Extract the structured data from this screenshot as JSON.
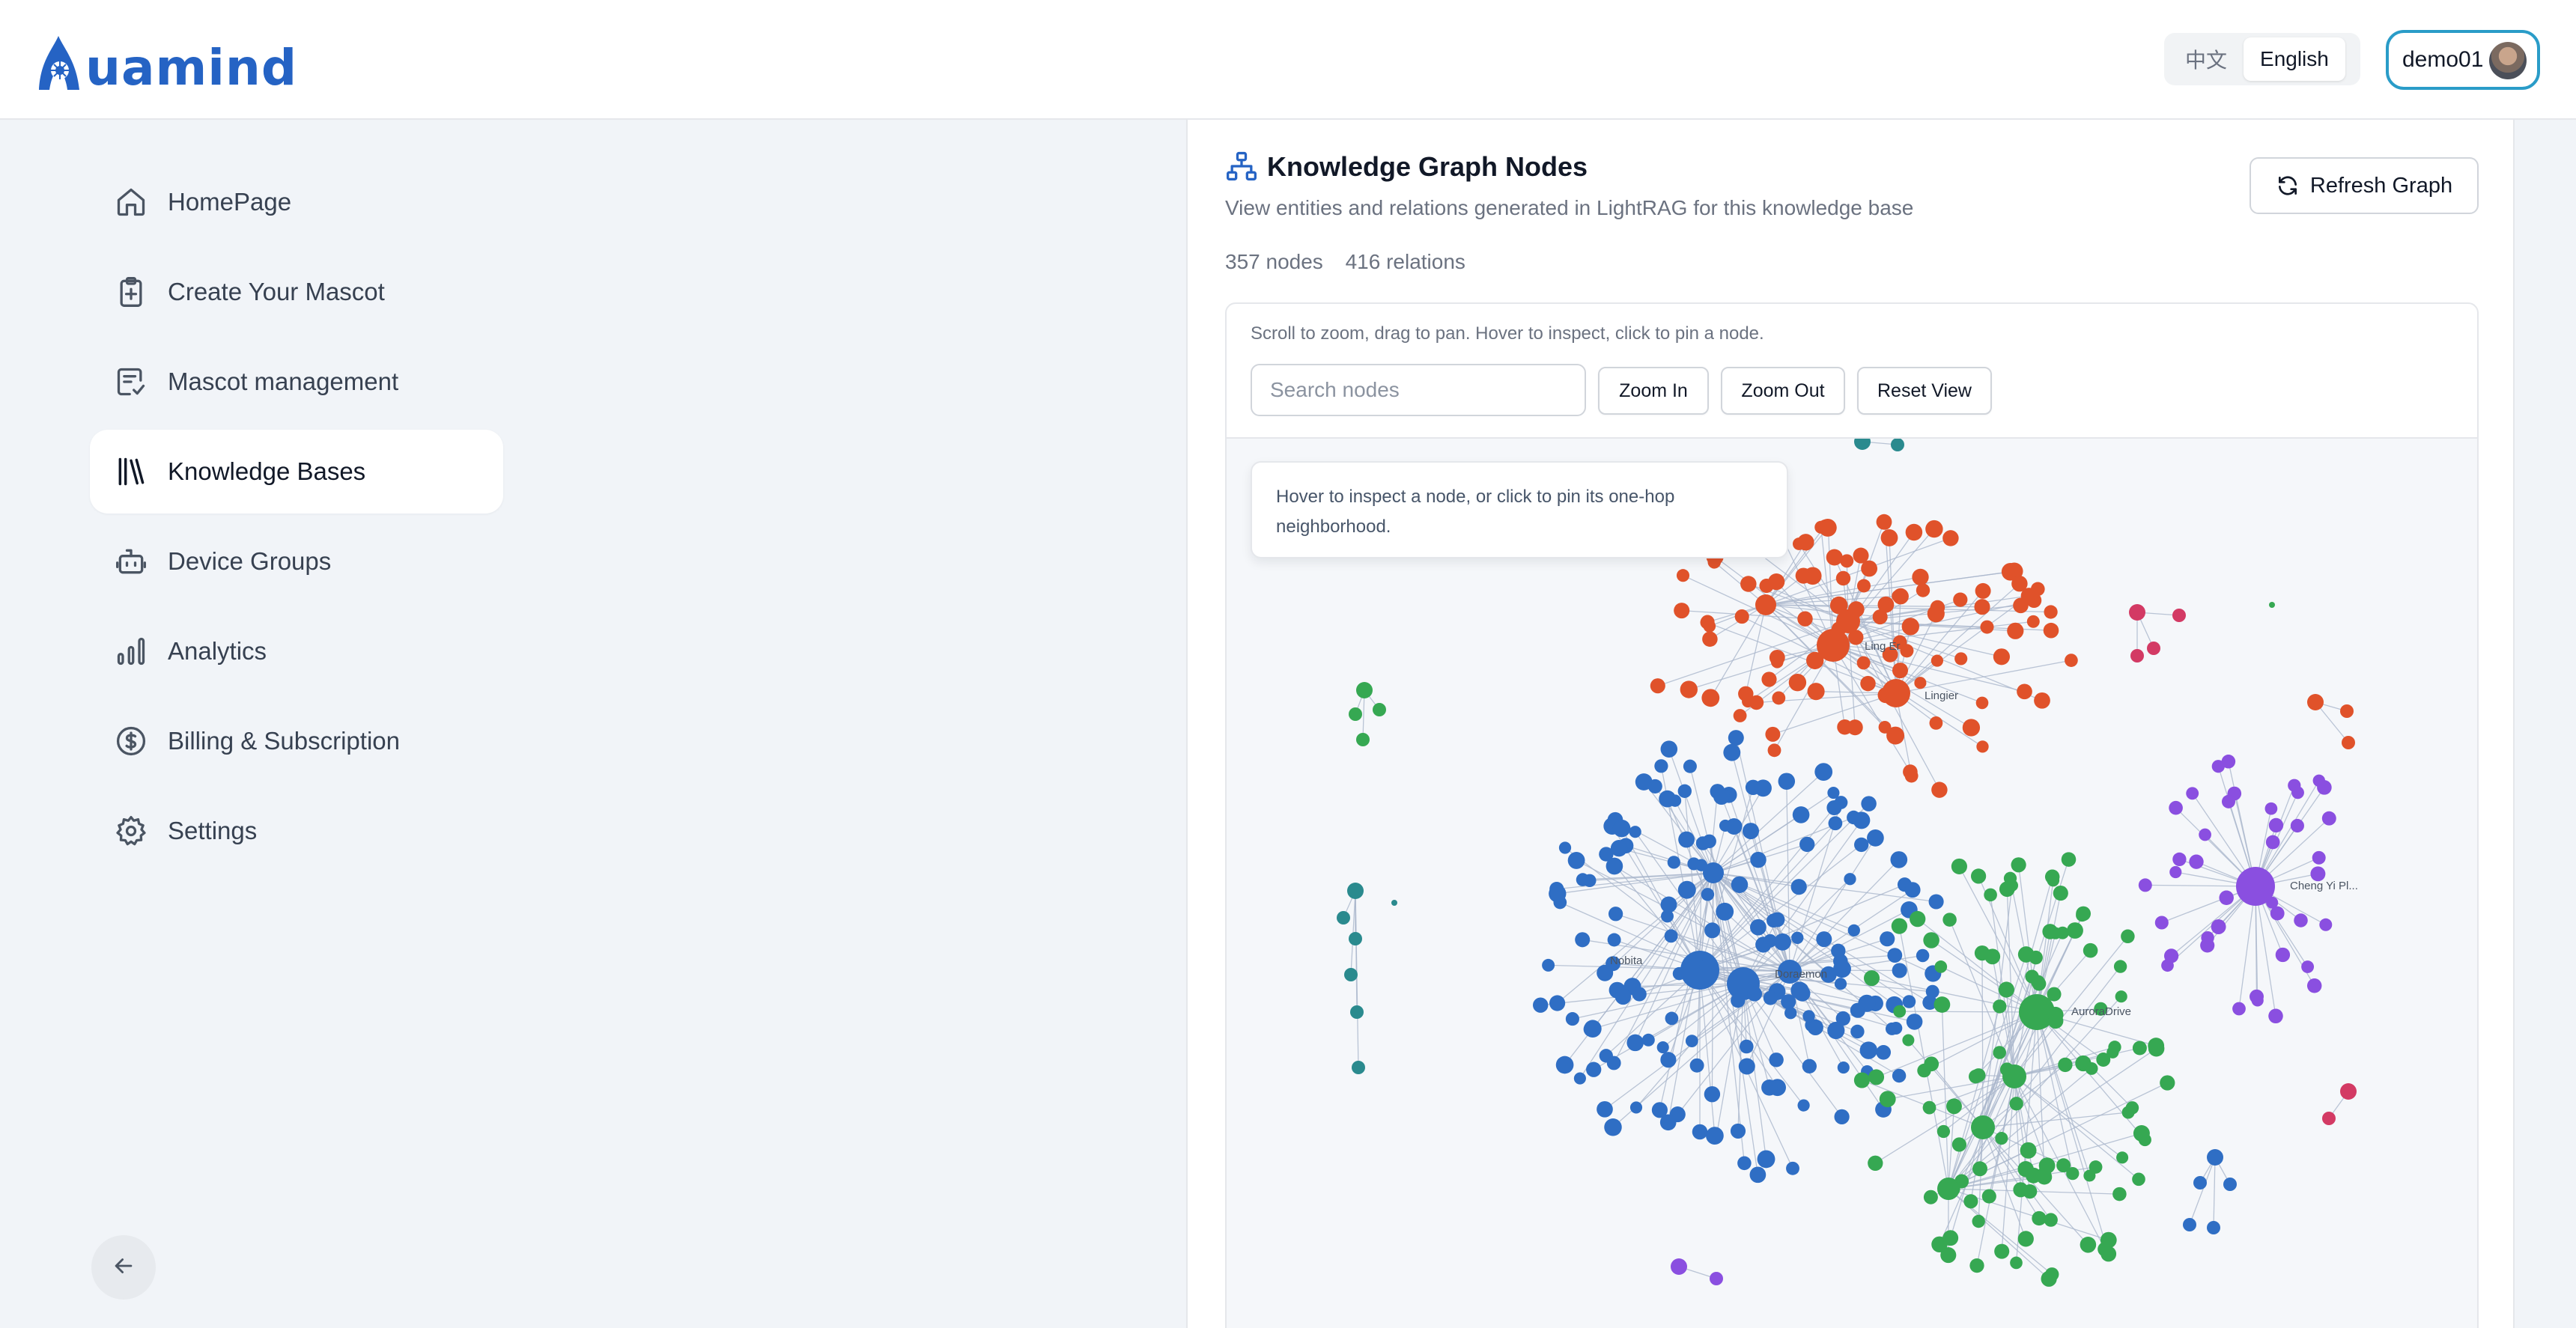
{
  "brand": {
    "name": "Aquamind",
    "logo_letter": "A",
    "logo_rest": "uamind"
  },
  "header": {
    "languages": [
      {
        "label": "中文",
        "active": false
      },
      {
        "label": "English",
        "active": true
      }
    ],
    "user": {
      "name": "demo01"
    }
  },
  "sidebar": {
    "items": [
      {
        "label": "HomePage",
        "icon": "home-icon",
        "active": false
      },
      {
        "label": "Create Your Mascot",
        "icon": "clipboard-plus-icon",
        "active": false
      },
      {
        "label": "Mascot management",
        "icon": "clipboard-check-icon",
        "active": false
      },
      {
        "label": "Knowledge Bases",
        "icon": "library-icon",
        "active": true
      },
      {
        "label": "Device Groups",
        "icon": "robot-icon",
        "active": false
      },
      {
        "label": "Analytics",
        "icon": "bar-chart-icon",
        "active": false
      },
      {
        "label": "Billing & Subscription",
        "icon": "dollar-circle-icon",
        "active": false
      },
      {
        "label": "Settings",
        "icon": "gear-icon",
        "active": false
      }
    ],
    "back_icon": "arrow-left-icon"
  },
  "panel": {
    "title": "Knowledge Graph Nodes",
    "subtitle": "View entities and relations generated in LightRAG for this knowledge base",
    "nodes_count": "357 nodes",
    "relations_count": "416 relations",
    "refresh_label": "Refresh Graph"
  },
  "graph": {
    "hint": "Scroll to zoom, drag to pan. Hover to inspect, click to pin a node.",
    "search_placeholder": "Search nodes",
    "zoom_in_label": "Zoom In",
    "zoom_out_label": "Zoom Out",
    "reset_label": "Reset View",
    "tooltip": "Hover to inspect a node, or click to pin its one-hop neighborhood.",
    "labels": {
      "ling_er": "Ling Er",
      "lingier": "Lingier",
      "nobita": "Nobita",
      "doraemon": "Doraemon",
      "auroradrive": "AuroraDrive",
      "cheng_yi": "Cheng Yi Pl..."
    },
    "colors": {
      "orange": "#e0522a",
      "blue": "#2f6ec4",
      "green": "#36a852",
      "purple": "#8a4fe0",
      "teal": "#2a8a8e",
      "pink": "#d33a64",
      "edge": "#aab6cc"
    }
  }
}
